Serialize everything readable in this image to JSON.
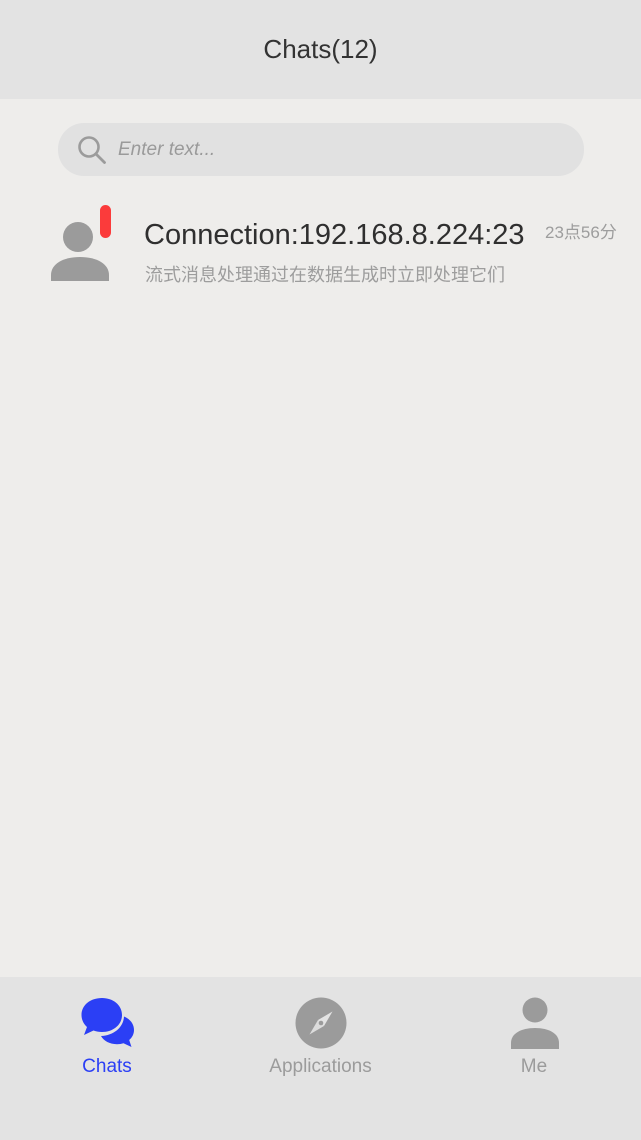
{
  "header": {
    "title": "Chats(12)"
  },
  "search": {
    "placeholder": "Enter text...",
    "value": ""
  },
  "chats": [
    {
      "title": "Connection:192.168.8.224:23",
      "time": "23点56分",
      "preview": "流式消息处理通过在数据生成时立即处理它们",
      "unread": true,
      "avatar_icon": "person-icon"
    }
  ],
  "tabbar": {
    "active": "chats",
    "active_color": "#2b3ff5",
    "inactive_color": "#9b9b9b",
    "tabs": [
      {
        "label": "Chats",
        "icon": "chat-bubbles-icon"
      },
      {
        "label": "Applications",
        "icon": "compass-icon"
      },
      {
        "label": "Me",
        "icon": "person-icon"
      }
    ]
  },
  "colors": {
    "header_bg": "#e3e3e3",
    "page_bg": "#eeedeb",
    "badge": "#fb3b3b"
  }
}
